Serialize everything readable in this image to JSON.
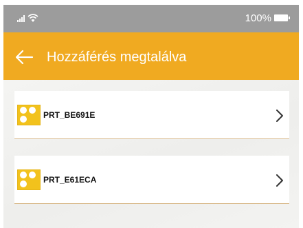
{
  "status_bar": {
    "battery_percent": "100%",
    "icons": [
      "signal-icon",
      "wifi-icon",
      "battery-icon"
    ]
  },
  "app_bar": {
    "back_icon": "arrow-left-icon",
    "title": "Hozzáférés megtalálva",
    "color": "#f0aa21"
  },
  "devices": {
    "items": [
      {
        "label": "PRT_BE691E",
        "icon": "device-icon",
        "action_icon": "chevron-right-icon"
      },
      {
        "label": "PRT_E61ECA",
        "icon": "device-icon",
        "action_icon": "chevron-right-icon"
      }
    ]
  },
  "colors": {
    "accent": "#f0aa21",
    "icon_yellow": "#f2c21c",
    "divider": "#d8b98a"
  }
}
